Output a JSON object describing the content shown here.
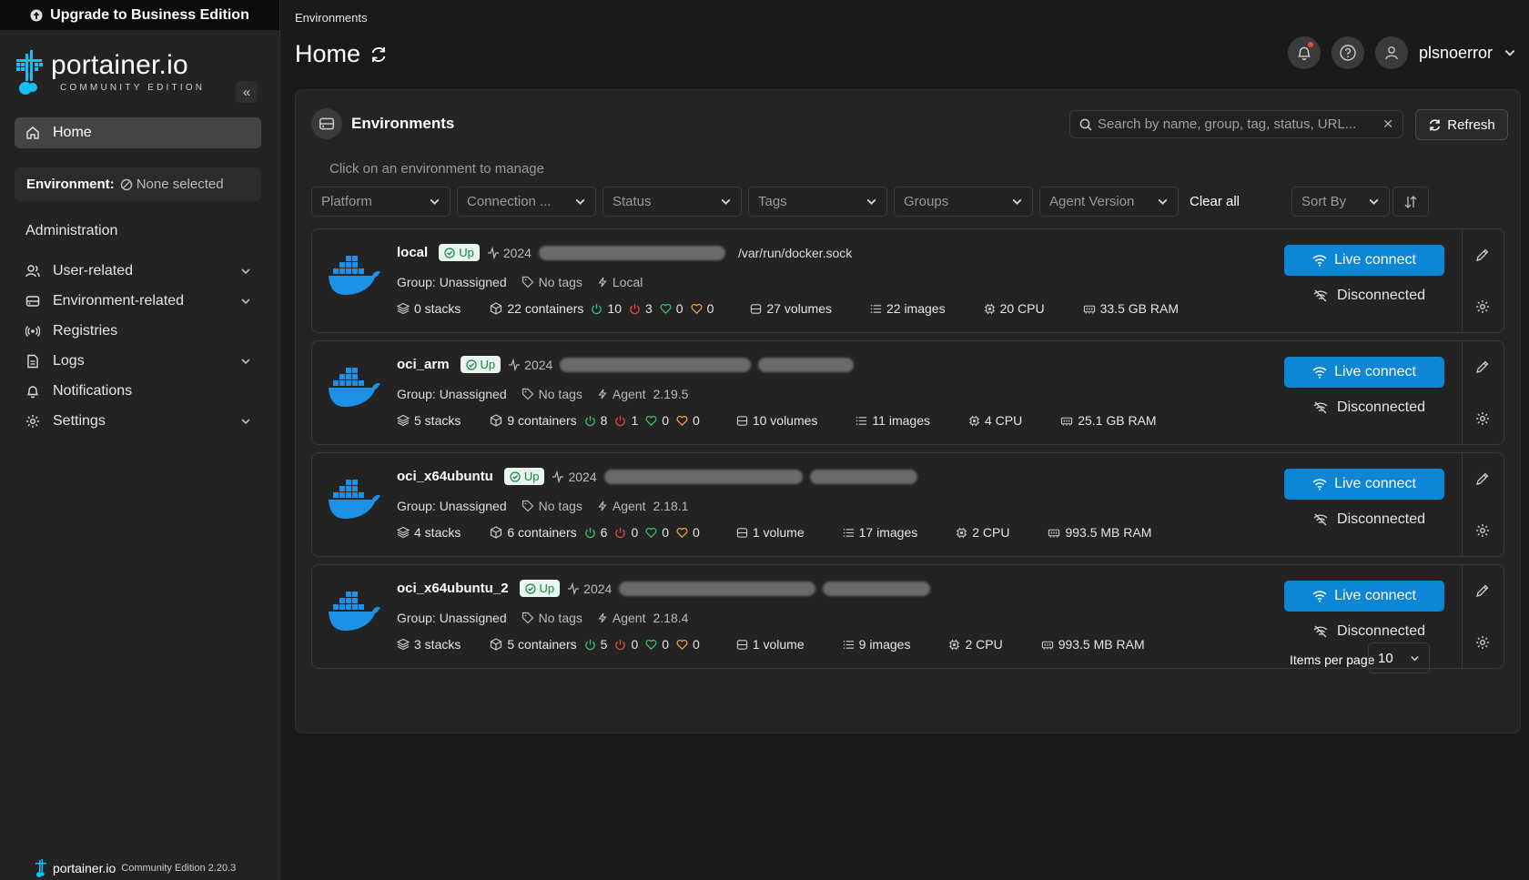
{
  "upgrade_banner": "Upgrade to Business Edition",
  "logo": {
    "name": "portainer.io",
    "edition": "COMMUNITY EDITION"
  },
  "nav": {
    "home": "Home",
    "environment_label": "Environment:",
    "environment_value": "None selected",
    "administration": "Administration",
    "items": [
      {
        "label": "User-related",
        "icon": "users-icon",
        "expandable": true
      },
      {
        "label": "Environment-related",
        "icon": "drive-icon",
        "expandable": true
      },
      {
        "label": "Registries",
        "icon": "radio-icon",
        "expandable": false
      },
      {
        "label": "Logs",
        "icon": "file-icon",
        "expandable": true
      },
      {
        "label": "Notifications",
        "icon": "bell-icon",
        "expandable": false
      },
      {
        "label": "Settings",
        "icon": "gear-icon",
        "expandable": true
      }
    ]
  },
  "footer": {
    "brand": "portainer.io",
    "version_text": "Community Edition 2.20.3"
  },
  "header": {
    "breadcrumb": "Environments",
    "title": "Home",
    "username": "plsnoerror"
  },
  "panel": {
    "title": "Environments",
    "search_placeholder": "Search by name, group, tag, status, URL...",
    "refresh_label": "Refresh",
    "hint": "Click on an environment to manage",
    "filters": [
      "Platform",
      "Connection ...",
      "Status",
      "Tags",
      "Groups",
      "Agent Version"
    ],
    "clear_all": "Clear all",
    "sort_by": "Sort By",
    "items_per_page_label": "Items per page",
    "items_per_page_value": "10"
  },
  "environments": [
    {
      "name": "local",
      "status": "Up",
      "heartbeat": "2024",
      "url": "/var/run/docker.sock",
      "group": "Group: Unassigned",
      "tags": "No tags",
      "type": "Local",
      "version": "",
      "stacks": "0 stacks",
      "containers": "22 containers",
      "running": "10",
      "stopped": "3",
      "healthy": "0",
      "unhealthy": "0",
      "volumes": "27 volumes",
      "images": "22 images",
      "cpu": "20 CPU",
      "ram": "33.5 GB RAM",
      "live_connect": "Live connect",
      "connection": "Disconnected"
    },
    {
      "name": "oci_arm",
      "status": "Up",
      "heartbeat": "2024",
      "url": "",
      "group": "Group: Unassigned",
      "tags": "No tags",
      "type": "Agent",
      "version": "2.19.5",
      "stacks": "5 stacks",
      "containers": "9 containers",
      "running": "8",
      "stopped": "1",
      "healthy": "0",
      "unhealthy": "0",
      "volumes": "10 volumes",
      "images": "11 images",
      "cpu": "4 CPU",
      "ram": "25.1 GB RAM",
      "live_connect": "Live connect",
      "connection": "Disconnected"
    },
    {
      "name": "oci_x64ubuntu",
      "status": "Up",
      "heartbeat": "2024",
      "url": "",
      "group": "Group: Unassigned",
      "tags": "No tags",
      "type": "Agent",
      "version": "2.18.1",
      "stacks": "4 stacks",
      "containers": "6 containers",
      "running": "6",
      "stopped": "0",
      "healthy": "0",
      "unhealthy": "0",
      "volumes": "1 volume",
      "images": "17 images",
      "cpu": "2 CPU",
      "ram": "993.5 MB RAM",
      "live_connect": "Live connect",
      "connection": "Disconnected"
    },
    {
      "name": "oci_x64ubuntu_2",
      "status": "Up",
      "heartbeat": "2024",
      "url": "",
      "group": "Group: Unassigned",
      "tags": "No tags",
      "type": "Agent",
      "version": "2.18.4",
      "stacks": "3 stacks",
      "containers": "5 containers",
      "running": "5",
      "stopped": "0",
      "healthy": "0",
      "unhealthy": "0",
      "volumes": "1 volume",
      "images": "9 images",
      "cpu": "2 CPU",
      "ram": "993.5 MB RAM",
      "live_connect": "Live connect",
      "connection": "Disconnected"
    }
  ],
  "colors": {
    "accent": "#0d86d6",
    "up_badge_bg": "#e7f6ee",
    "up_badge_fg": "#1a7f46",
    "running": "#3ec26b",
    "stopped": "#e8473e",
    "unhealthy": "#f0a83a"
  }
}
